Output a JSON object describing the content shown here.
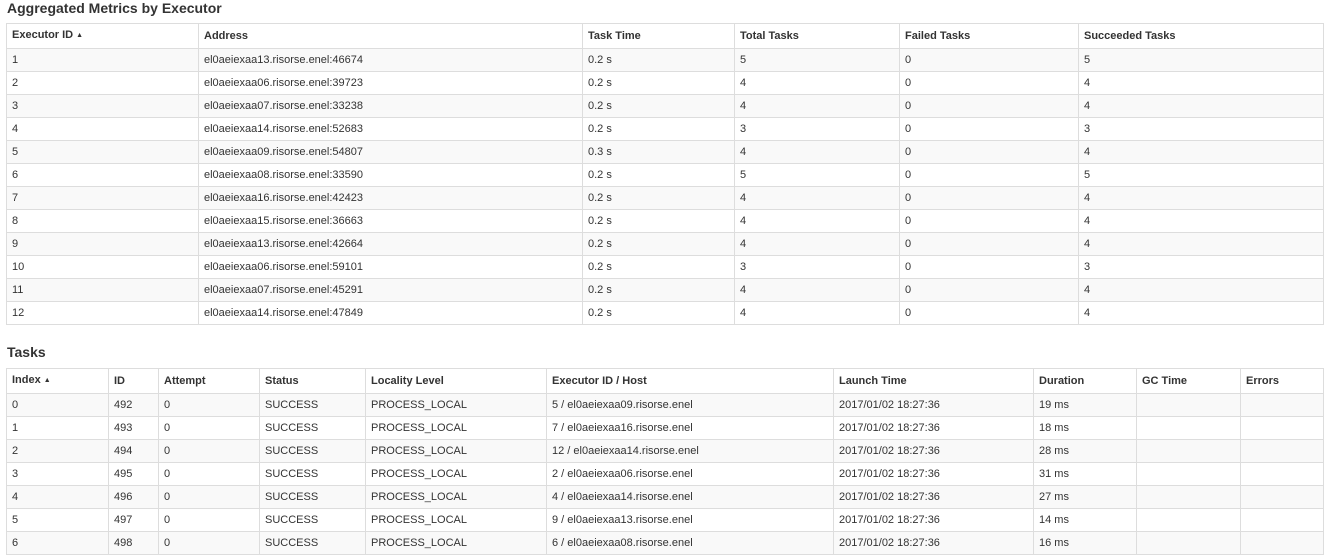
{
  "aggregated": {
    "title": "Aggregated Metrics by Executor",
    "sort_indicator": "▲",
    "headers": [
      "Executor ID",
      "Address",
      "Task Time",
      "Total Tasks",
      "Failed Tasks",
      "Succeeded Tasks"
    ],
    "rows": [
      [
        "1",
        "el0aeiexaa13.risorse.enel:46674",
        "0.2 s",
        "5",
        "0",
        "5"
      ],
      [
        "2",
        "el0aeiexaa06.risorse.enel:39723",
        "0.2 s",
        "4",
        "0",
        "4"
      ],
      [
        "3",
        "el0aeiexaa07.risorse.enel:33238",
        "0.2 s",
        "4",
        "0",
        "4"
      ],
      [
        "4",
        "el0aeiexaa14.risorse.enel:52683",
        "0.2 s",
        "3",
        "0",
        "3"
      ],
      [
        "5",
        "el0aeiexaa09.risorse.enel:54807",
        "0.3 s",
        "4",
        "0",
        "4"
      ],
      [
        "6",
        "el0aeiexaa08.risorse.enel:33590",
        "0.2 s",
        "5",
        "0",
        "5"
      ],
      [
        "7",
        "el0aeiexaa16.risorse.enel:42423",
        "0.2 s",
        "4",
        "0",
        "4"
      ],
      [
        "8",
        "el0aeiexaa15.risorse.enel:36663",
        "0.2 s",
        "4",
        "0",
        "4"
      ],
      [
        "9",
        "el0aeiexaa13.risorse.enel:42664",
        "0.2 s",
        "4",
        "0",
        "4"
      ],
      [
        "10",
        "el0aeiexaa06.risorse.enel:59101",
        "0.2 s",
        "3",
        "0",
        "3"
      ],
      [
        "11",
        "el0aeiexaa07.risorse.enel:45291",
        "0.2 s",
        "4",
        "0",
        "4"
      ],
      [
        "12",
        "el0aeiexaa14.risorse.enel:47849",
        "0.2 s",
        "4",
        "0",
        "4"
      ]
    ]
  },
  "tasks": {
    "title": "Tasks",
    "sort_indicator": "▲",
    "headers": [
      "Index",
      "ID",
      "Attempt",
      "Status",
      "Locality Level",
      "Executor ID / Host",
      "Launch Time",
      "Duration",
      "GC Time",
      "Errors"
    ],
    "rows": [
      [
        "0",
        "492",
        "0",
        "SUCCESS",
        "PROCESS_LOCAL",
        "5 / el0aeiexaa09.risorse.enel",
        "2017/01/02 18:27:36",
        "19 ms",
        "",
        ""
      ],
      [
        "1",
        "493",
        "0",
        "SUCCESS",
        "PROCESS_LOCAL",
        "7 / el0aeiexaa16.risorse.enel",
        "2017/01/02 18:27:36",
        "18 ms",
        "",
        ""
      ],
      [
        "2",
        "494",
        "0",
        "SUCCESS",
        "PROCESS_LOCAL",
        "12 / el0aeiexaa14.risorse.enel",
        "2017/01/02 18:27:36",
        "28 ms",
        "",
        ""
      ],
      [
        "3",
        "495",
        "0",
        "SUCCESS",
        "PROCESS_LOCAL",
        "2 / el0aeiexaa06.risorse.enel",
        "2017/01/02 18:27:36",
        "31 ms",
        "",
        ""
      ],
      [
        "4",
        "496",
        "0",
        "SUCCESS",
        "PROCESS_LOCAL",
        "4 / el0aeiexaa14.risorse.enel",
        "2017/01/02 18:27:36",
        "27 ms",
        "",
        ""
      ],
      [
        "5",
        "497",
        "0",
        "SUCCESS",
        "PROCESS_LOCAL",
        "9 / el0aeiexaa13.risorse.enel",
        "2017/01/02 18:27:36",
        "14 ms",
        "",
        ""
      ],
      [
        "6",
        "498",
        "0",
        "SUCCESS",
        "PROCESS_LOCAL",
        "6 / el0aeiexaa08.risorse.enel",
        "2017/01/02 18:27:36",
        "16 ms",
        "",
        ""
      ]
    ]
  }
}
